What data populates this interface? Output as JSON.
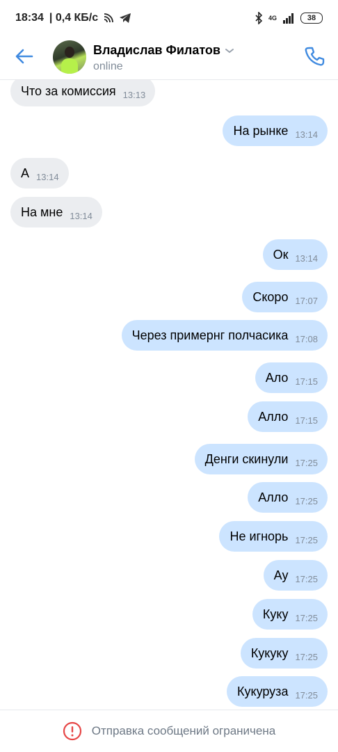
{
  "status_bar": {
    "time": "18:34",
    "speed": "| 0,4 КБ/с",
    "network": "4G",
    "battery": "38"
  },
  "header": {
    "name": "Владислав Филатов",
    "status": "online"
  },
  "messages": [
    {
      "dir": "in",
      "text": "Что за комиссия",
      "time": "13:13"
    },
    {
      "dir": "out",
      "text": "На рынке",
      "time": "13:14"
    },
    {
      "dir": "in",
      "text": "А",
      "time": "13:14"
    },
    {
      "dir": "in",
      "text": "На мне",
      "time": "13:14"
    },
    {
      "dir": "out",
      "text": "Ок",
      "time": "13:14"
    },
    {
      "dir": "out",
      "text": "Скоро",
      "time": "17:07"
    },
    {
      "dir": "out",
      "text": "Через примернг полчасика",
      "time": "17:08"
    },
    {
      "dir": "out",
      "text": "Ало",
      "time": "17:15"
    },
    {
      "dir": "out",
      "text": "Алло",
      "time": "17:15"
    },
    {
      "dir": "out",
      "text": "Денги скинули",
      "time": "17:25"
    },
    {
      "dir": "out",
      "text": "Алло",
      "time": "17:25"
    },
    {
      "dir": "out",
      "text": "Не игнорь",
      "time": "17:25"
    },
    {
      "dir": "out",
      "text": "Ау",
      "time": "17:25"
    },
    {
      "dir": "out",
      "text": "Куку",
      "time": "17:25"
    },
    {
      "dir": "out",
      "text": "Кукуку",
      "time": "17:25"
    },
    {
      "dir": "out",
      "text": "Кукуруза",
      "time": "17:25"
    }
  ],
  "footer": {
    "text": "Отправка сообщений ограничена"
  },
  "colors": {
    "accent": "#3f8ae0",
    "outgoing_bubble": "#cce4ff",
    "incoming_bubble": "#ebedf0",
    "error": "#e64646"
  }
}
